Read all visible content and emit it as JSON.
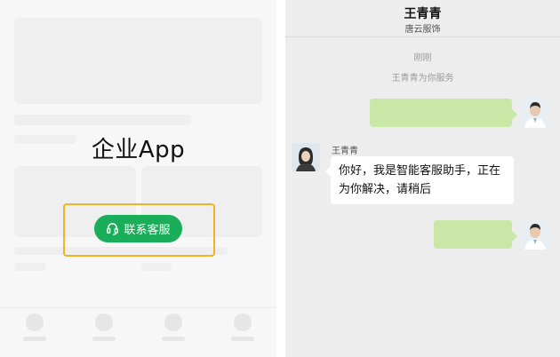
{
  "left": {
    "app_title": "企业App",
    "contact_button_label": "联系客服"
  },
  "chat": {
    "contact_name": "王青青",
    "organization": "唐云服饰",
    "timestamp": "刚刚",
    "service_notice": "王青青为你服务",
    "agent_name": "王青青",
    "agent_message": "你好，我是智能客服助手，正在为你解决，请稍后"
  },
  "colors": {
    "accent_green": "#1aad5a",
    "highlight_border": "#f0b323",
    "user_bubble": "#c9e7a7",
    "chat_background": "#ededed"
  },
  "icons": {
    "contact_button_icon": "headset-icon"
  }
}
